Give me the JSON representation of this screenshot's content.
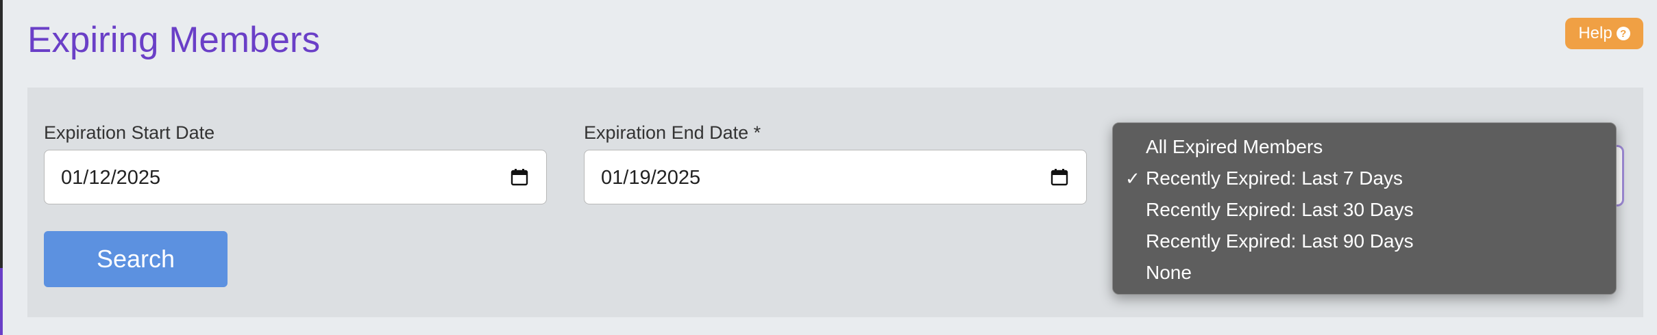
{
  "page": {
    "title": "Expiring Members",
    "help_label": "Help",
    "help_icon_glyph": "?"
  },
  "filters": {
    "start_date_label": "Expiration Start Date",
    "start_date_value": "01/12/2025",
    "end_date_label": "Expiration End Date *",
    "end_date_value": "01/19/2025",
    "search_label": "Search"
  },
  "status_dropdown": {
    "selected": "Recently Expired: Last 7 Days",
    "check_glyph": "✓",
    "options": [
      "All Expired Members",
      "Recently Expired: Last 7 Days",
      "Recently Expired: Last 30 Days",
      "Recently Expired: Last 90 Days",
      "None"
    ]
  },
  "colors": {
    "title": "#6a3fc7",
    "help_button": "#f0a044",
    "search_button": "#5c91e0",
    "dropdown_bg": "#5e5e5e"
  },
  "icons": {
    "help": "question-circle-icon",
    "date": "calendar-icon",
    "selected_option": "checkmark-icon"
  }
}
